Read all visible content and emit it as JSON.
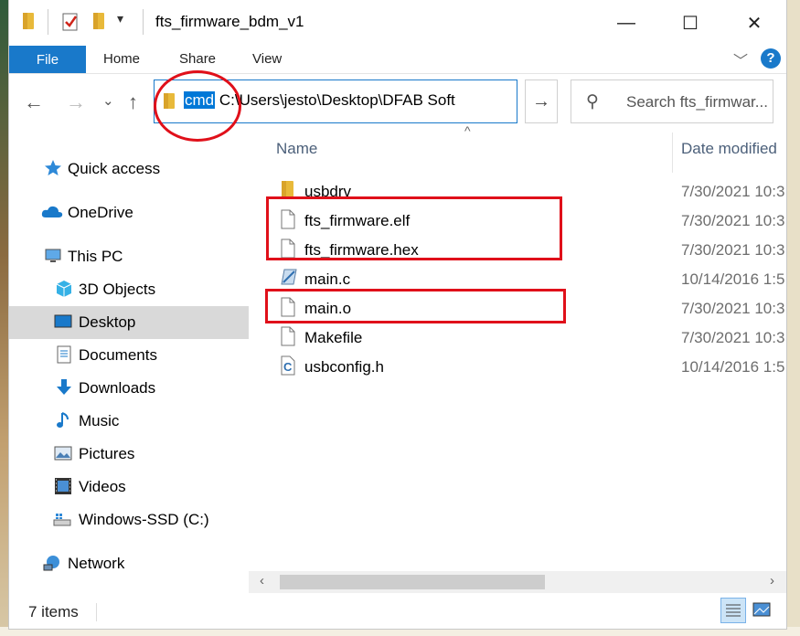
{
  "window": {
    "title": "fts_firmware_bdm_v1",
    "minimize_glyph": "—",
    "maximize_glyph": "☐",
    "close_glyph": "✕"
  },
  "ribbon": {
    "tabs": [
      "File",
      "Home",
      "Share",
      "View"
    ],
    "expand_glyph": "﹀",
    "help_glyph": "?"
  },
  "navbar": {
    "back_glyph": "←",
    "forward_glyph": "→",
    "recent_glyph": "⌄",
    "up_glyph": "↑",
    "address_selected": "cmd",
    "address_rest": " C:\\Users\\jesto\\Desktop\\DFAB Soft",
    "address_dropdown_glyph": "⌄",
    "go_glyph": "→",
    "search_glyph": "⚲",
    "search_placeholder": "Search fts_firmwar..."
  },
  "sidebar": {
    "items": [
      {
        "label": "Quick access",
        "icon": "star-icon"
      },
      {
        "label": "OneDrive",
        "icon": "cloud-icon"
      },
      {
        "label": "This PC",
        "icon": "computer-icon"
      },
      {
        "label": "3D Objects",
        "icon": "cube-icon"
      },
      {
        "label": "Desktop",
        "icon": "desktop-icon",
        "selected": true
      },
      {
        "label": "Documents",
        "icon": "document-icon"
      },
      {
        "label": "Downloads",
        "icon": "download-icon"
      },
      {
        "label": "Music",
        "icon": "music-icon"
      },
      {
        "label": "Pictures",
        "icon": "pictures-icon"
      },
      {
        "label": "Videos",
        "icon": "videos-icon"
      },
      {
        "label": "Windows-SSD (C:)",
        "icon": "drive-icon"
      },
      {
        "label": "Network",
        "icon": "network-icon"
      }
    ]
  },
  "files": {
    "columns": [
      "Name",
      "Date modified"
    ],
    "sort_glyph": "^",
    "rows": [
      {
        "name": "usbdrv",
        "date": "7/30/2021 10:3",
        "icon": "folder-icon"
      },
      {
        "name": "fts_firmware.elf",
        "date": "7/30/2021 10:3",
        "icon": "file-icon"
      },
      {
        "name": "fts_firmware.hex",
        "date": "7/30/2021 10:3",
        "icon": "file-icon"
      },
      {
        "name": "main.c",
        "date": "10/14/2016 1:5",
        "icon": "c-source-icon"
      },
      {
        "name": "main.o",
        "date": "7/30/2021 10:3",
        "icon": "file-icon"
      },
      {
        "name": "Makefile",
        "date": "7/30/2021 10:3",
        "icon": "file-icon"
      },
      {
        "name": "usbconfig.h",
        "date": "10/14/2016 1:5",
        "icon": "c-header-icon"
      }
    ]
  },
  "scroll": {
    "left_glyph": "‹",
    "right_glyph": "›"
  },
  "status": {
    "item_count": "7 items"
  },
  "colors": {
    "accent": "#1979ca",
    "selection": "#0078d7",
    "annotation": "#e0101a"
  }
}
